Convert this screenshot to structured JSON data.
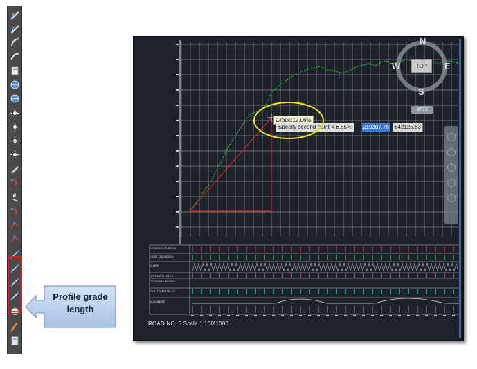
{
  "toolbar": {
    "buttons": [
      {
        "icon": "line-tool-icon"
      },
      {
        "icon": "line-tool-icon"
      },
      {
        "icon": "arc-tool-icon"
      },
      {
        "icon": "polyline-tool-icon"
      },
      {
        "icon": "document-icon"
      },
      {
        "icon": "globe-icon"
      },
      {
        "icon": "globe-icon"
      },
      {
        "icon": "point-tool-icon"
      },
      {
        "icon": "point-tool-icon"
      },
      {
        "icon": "point-tool-icon"
      },
      {
        "icon": "point-tool-icon"
      },
      {
        "icon": "pen-tool-icon"
      },
      {
        "icon": "curve-tool-icon"
      },
      {
        "icon": "move-tool-icon"
      },
      {
        "icon": "curve-tool-icon"
      },
      {
        "icon": "node-tool-icon"
      },
      {
        "icon": "node-tool-icon"
      },
      {
        "icon": "profile-grade-icon"
      },
      {
        "icon": "profile-grade-icon"
      },
      {
        "icon": "profile-grade-icon"
      },
      {
        "icon": "profile-grade-icon"
      },
      {
        "icon": "eraser-icon"
      },
      {
        "icon": "brush-icon"
      },
      {
        "icon": "calculator-icon"
      }
    ]
  },
  "callout": {
    "text": "Profile grade length"
  },
  "cad": {
    "grade_tooltip": "Grade:12.06%",
    "prompt": "Specify second point <-6.85>:",
    "coord_x": "219307.78",
    "coord_y": "642125.63",
    "viewcube": {
      "north": "N",
      "south": "S",
      "east": "E",
      "west": "W",
      "face": "TOP"
    },
    "wcs": "WCS",
    "caption": "ROAD NO. 5   Scale 1:100\\1000",
    "row_labels": [
      "DESIGN ELEVATION",
      "EXIST ELEVATION",
      "SLOPE",
      "LEFT DITCH ELEV",
      "CROSSING ROADS",
      "RIGHT DITCH ELEV",
      "ALIGNMENT"
    ],
    "colors": {
      "background": "#1e232b",
      "grid": "#d6d6d6",
      "profile": "#2fd62f",
      "grade_line": "#e02828",
      "highlight": "#f0e51a",
      "callout_fill": "#bcd3ee"
    }
  }
}
